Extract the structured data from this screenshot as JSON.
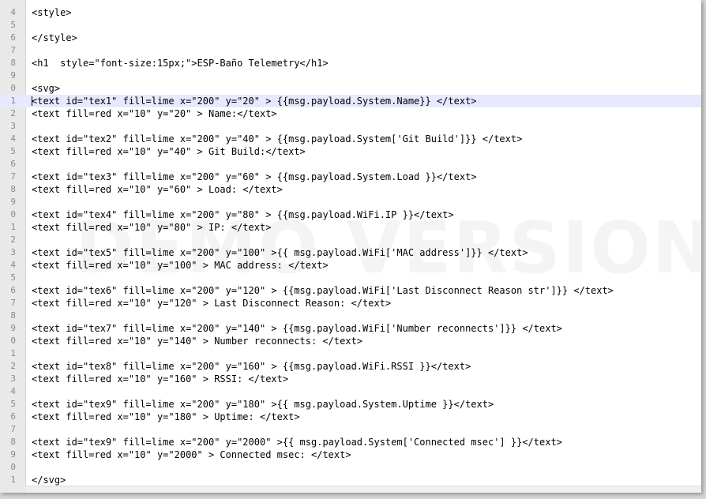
{
  "editor": {
    "watermark": "DEMO VERSION",
    "current_line": 11,
    "lines": [
      {
        "num": "4",
        "text": "<style>"
      },
      {
        "num": "5",
        "text": ""
      },
      {
        "num": "6",
        "text": "</style>"
      },
      {
        "num": "7",
        "text": ""
      },
      {
        "num": "8",
        "text": "<h1  style=\"font-size:15px;\">ESP-Baño Telemetry</h1>"
      },
      {
        "num": "9",
        "text": ""
      },
      {
        "num": "0",
        "text": "<svg>"
      },
      {
        "num": "1",
        "text": "<text id=\"tex1\" fill=lime x=\"200\" y=\"20\" > {{msg.payload.System.Name}} </text>"
      },
      {
        "num": "2",
        "text": "<text fill=red x=\"10\" y=\"20\" > Name:</text>"
      },
      {
        "num": "3",
        "text": ""
      },
      {
        "num": "4",
        "text": "<text id=\"tex2\" fill=lime x=\"200\" y=\"40\" > {{msg.payload.System['Git Build']}} </text>"
      },
      {
        "num": "5",
        "text": "<text fill=red x=\"10\" y=\"40\" > Git Build:</text>"
      },
      {
        "num": "6",
        "text": ""
      },
      {
        "num": "7",
        "text": "<text id=\"tex3\" fill=lime x=\"200\" y=\"60\" > {{msg.payload.System.Load }}</text>"
      },
      {
        "num": "8",
        "text": "<text fill=red x=\"10\" y=\"60\" > Load: </text>"
      },
      {
        "num": "9",
        "text": ""
      },
      {
        "num": "0",
        "text": "<text id=\"tex4\" fill=lime x=\"200\" y=\"80\" > {{msg.payload.WiFi.IP }}</text>"
      },
      {
        "num": "1",
        "text": "<text fill=red x=\"10\" y=\"80\" > IP: </text>"
      },
      {
        "num": "2",
        "text": ""
      },
      {
        "num": "3",
        "text": "<text id=\"tex5\" fill=lime x=\"200\" y=\"100\" >{{ msg.payload.WiFi['MAC address']}} </text>"
      },
      {
        "num": "4",
        "text": "<text fill=red x=\"10\" y=\"100\" > MAC address: </text>"
      },
      {
        "num": "5",
        "text": ""
      },
      {
        "num": "6",
        "text": "<text id=\"tex6\" fill=lime x=\"200\" y=\"120\" > {{msg.payload.WiFi['Last Disconnect Reason str']}} </text>"
      },
      {
        "num": "7",
        "text": "<text fill=red x=\"10\" y=\"120\" > Last Disconnect Reason: </text>"
      },
      {
        "num": "8",
        "text": ""
      },
      {
        "num": "9",
        "text": "<text id=\"tex7\" fill=lime x=\"200\" y=\"140\" > {{msg.payload.WiFi['Number reconnects']}} </text>"
      },
      {
        "num": "0",
        "text": "<text fill=red x=\"10\" y=\"140\" > Number reconnects: </text>"
      },
      {
        "num": "1",
        "text": ""
      },
      {
        "num": "2",
        "text": "<text id=\"tex8\" fill=lime x=\"200\" y=\"160\" > {{msg.payload.WiFi.RSSI }}</text>"
      },
      {
        "num": "3",
        "text": "<text fill=red x=\"10\" y=\"160\" > RSSI: </text>"
      },
      {
        "num": "4",
        "text": ""
      },
      {
        "num": "5",
        "text": "<text id=\"tex9\" fill=lime x=\"200\" y=\"180\" >{{ msg.payload.System.Uptime }}</text>"
      },
      {
        "num": "6",
        "text": "<text fill=red x=\"10\" y=\"180\" > Uptime: </text>"
      },
      {
        "num": "7",
        "text": ""
      },
      {
        "num": "8",
        "text": "<text id=\"tex9\" fill=lime x=\"200\" y=\"2000\" >{{ msg.payload.System['Connected msec'] }}</text>"
      },
      {
        "num": "9",
        "text": "<text fill=red x=\"10\" y=\"2000\" > Connected msec: </text>"
      },
      {
        "num": "0",
        "text": ""
      },
      {
        "num": "1",
        "text": "</svg>"
      }
    ]
  }
}
